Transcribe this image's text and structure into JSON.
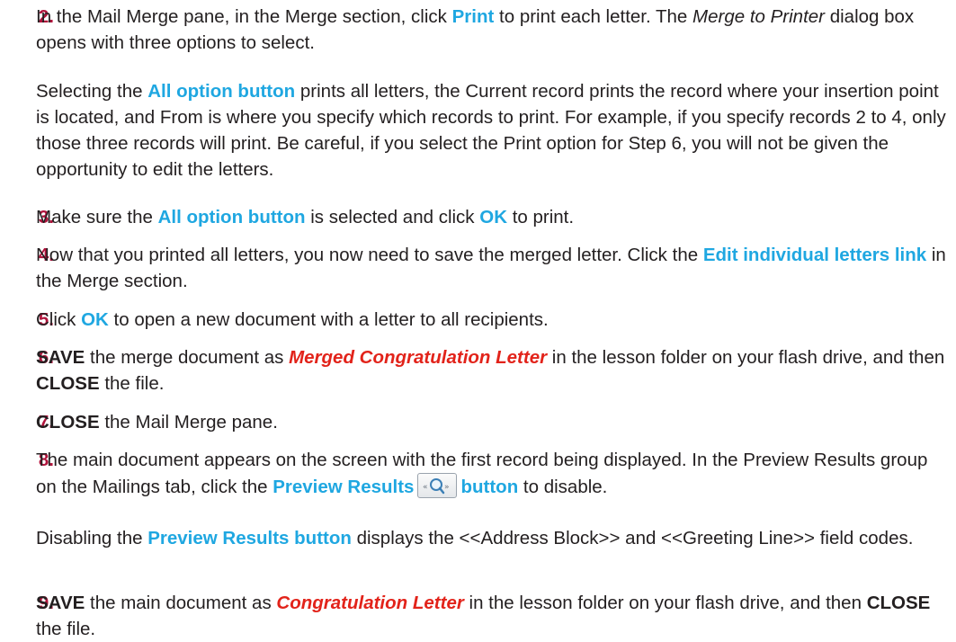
{
  "steps": [
    {
      "num": "2.",
      "parts": [
        "In the Mail Merge pane, in the Merge section, click ",
        "Print",
        " to print each letter. The ",
        "Merge to Printer",
        " dialog box opens with three options to select."
      ]
    },
    {
      "para": [
        "Selecting the ",
        "All option button",
        " prints all letters, the Current record prints the record where your insertion point is located, and From is where you specify which records to print. For example, if you specify records 2 to 4, only those three records will print. Be careful, if you select the Print option for Step 6, you will not be given the opportunity to edit the letters."
      ]
    },
    {
      "num": "3.",
      "parts": [
        "Make sure the ",
        "All option button",
        " is selected and click ",
        "OK",
        " to print."
      ]
    },
    {
      "num": "4.",
      "parts": [
        "Now that you printed all letters, you now need to save the merged letter. Click the ",
        "Edit individual letters link",
        " in the Merge section."
      ]
    },
    {
      "num": "5.",
      "parts": [
        "Click ",
        "OK",
        " to open a new document with a letter to all recipients."
      ]
    },
    {
      "num": "6.",
      "parts": [
        "SAVE",
        " the merge document as ",
        "Merged Congratulation Letter",
        " in the lesson folder on your flash drive, and then ",
        "CLOSE",
        " the file."
      ]
    },
    {
      "num": "7.",
      "parts": [
        "CLOSE",
        " the Mail Merge pane."
      ]
    },
    {
      "num": "8.",
      "parts": [
        "The main document appears on the screen with the first record being displayed. In the Preview Results group on the Mailings tab, click the ",
        "Preview Results",
        "button",
        " to disable."
      ]
    },
    {
      "para": [
        "Disabling the ",
        "Preview Results button",
        " displays the <<Address Block>> and <<Greeting Line>> field codes."
      ]
    },
    {
      "num": "9.",
      "parts": [
        "SAVE",
        " the main document as ",
        "Congratulation Letter",
        " in the lesson folder on your flash drive, and then ",
        "CLOSE",
        " the file."
      ]
    }
  ],
  "icons": {
    "preview_results": "preview-results-icon"
  },
  "colors": {
    "step_number": "#b0143c",
    "highlight": "#1fa7e1",
    "filename": "#e2231a",
    "text": "#231f20"
  }
}
